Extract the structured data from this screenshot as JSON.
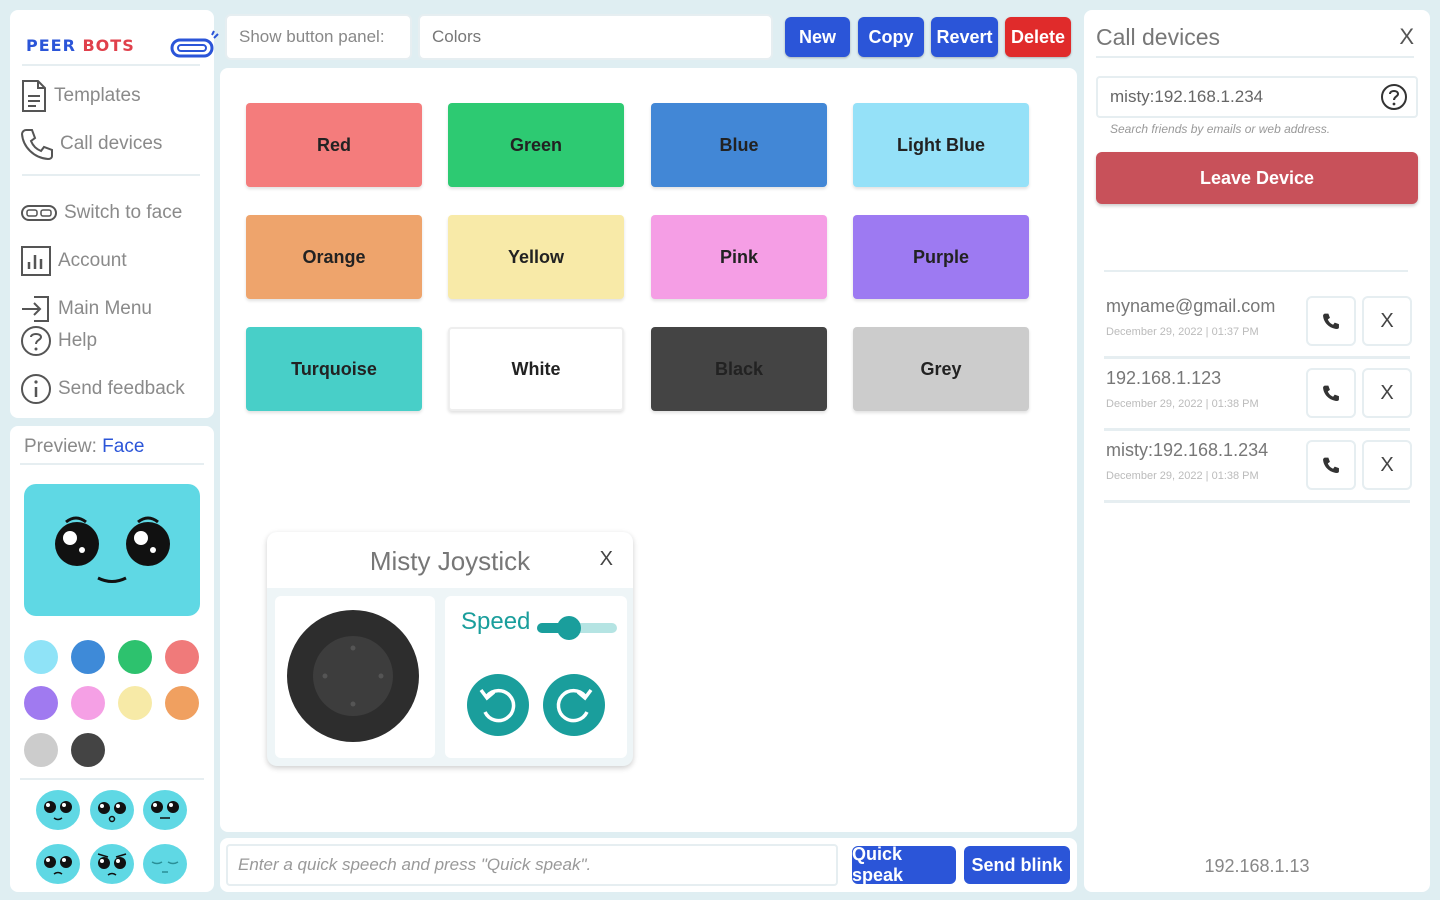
{
  "app": {
    "brand_part1": "PEER",
    "brand_part2": "BOTS"
  },
  "nav": {
    "templates": "Templates",
    "call_devices": "Call devices",
    "switch_to_face": "Switch to face",
    "account": "Account",
    "main_menu": "Main Menu",
    "help": "Help",
    "send_feedback": "Send feedback"
  },
  "preview": {
    "label": "Preview:",
    "mode": "Face",
    "swatches": [
      "#8fe3f7",
      "#3e8ad8",
      "#2dc26e",
      "#f07a7a",
      "#a07af0",
      "#f5a0e5",
      "#f7eaa7",
      "#f0a060",
      "#cccccc",
      "#444444"
    ]
  },
  "toolbar": {
    "panel_label": "Show button panel:",
    "panel_value": "Colors",
    "new": "New",
    "copy": "Copy",
    "revert": "Revert",
    "delete": "Delete"
  },
  "colors": [
    {
      "label": "Red",
      "color": "#f47c7c"
    },
    {
      "label": "Green",
      "color": "#2dca72"
    },
    {
      "label": "Blue",
      "color": "#4287d6"
    },
    {
      "label": "Light Blue",
      "color": "#95e1f8"
    },
    {
      "label": "Orange",
      "color": "#eea46c"
    },
    {
      "label": "Yellow",
      "color": "#f8eaa8"
    },
    {
      "label": "Pink",
      "color": "#f59ee5"
    },
    {
      "label": "Purple",
      "color": "#9d7af2"
    },
    {
      "label": "Turquoise",
      "color": "#48cfc8"
    },
    {
      "label": "White",
      "color": "#ffffff"
    },
    {
      "label": "Black",
      "color": "#444444"
    },
    {
      "label": "Grey",
      "color": "#cccccc"
    }
  ],
  "joystick": {
    "title": "Misty Joystick",
    "close": "X",
    "speed_label": "Speed",
    "speed_level": 0.35
  },
  "bottom": {
    "speech_placeholder": "Enter a quick speech and press \"Quick speak\".",
    "quick_speak": "Quick speak",
    "send_blink": "Send blink"
  },
  "call_devices": {
    "title": "Call devices",
    "close": "X",
    "address": "misty:192.168.1.234",
    "hint": "Search friends by emails or web address.",
    "leave": "Leave Device",
    "devices": [
      {
        "name": "myname@gmail.com",
        "date": "December 29, 2022 | 01:37 PM",
        "remove": "X"
      },
      {
        "name": "192.168.1.123",
        "date": "December 29, 2022 | 01:38 PM",
        "remove": "X"
      },
      {
        "name": "misty:192.168.1.234",
        "date": "December 29, 2022 | 01:38 PM",
        "remove": "X"
      }
    ],
    "footer_ip": "192.168.1.13"
  }
}
